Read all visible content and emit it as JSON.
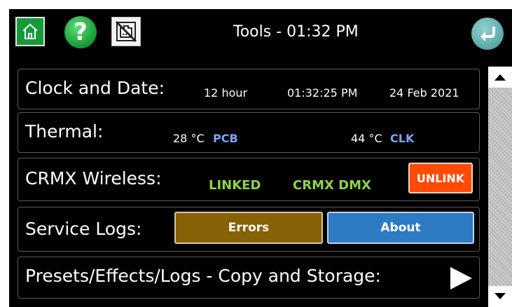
{
  "header": {
    "title": "Tools - 01:32 PM",
    "home_icon": "home-icon",
    "help_icon": "question-icon",
    "network_icon": "network-disconnected-icon",
    "back_icon": "back-arrow-icon"
  },
  "clock": {
    "label": "Clock and Date:",
    "format": "12 hour",
    "time": "01:32:25 PM",
    "date": "24 Feb 2021"
  },
  "thermal": {
    "label": "Thermal:",
    "pcb_value": "28 °C",
    "pcb_label": "PCB",
    "clk_value": "44 °C",
    "clk_label": "CLK"
  },
  "crmx": {
    "label": "CRMX Wireless:",
    "status": "LINKED",
    "mode": "CRMX DMX",
    "unlink_label": "UNLINK"
  },
  "service": {
    "label": "Service Logs:",
    "errors_label": "Errors",
    "about_label": "About"
  },
  "presets": {
    "label": "Presets/Effects/Logs - Copy and Storage:"
  },
  "colors": {
    "background": "#000000",
    "green_status": "#8fd347",
    "blue_sensor": "#7fa3ff",
    "unlink": "#ff4a05",
    "errors": "#876106",
    "about": "#2e7bc4"
  }
}
